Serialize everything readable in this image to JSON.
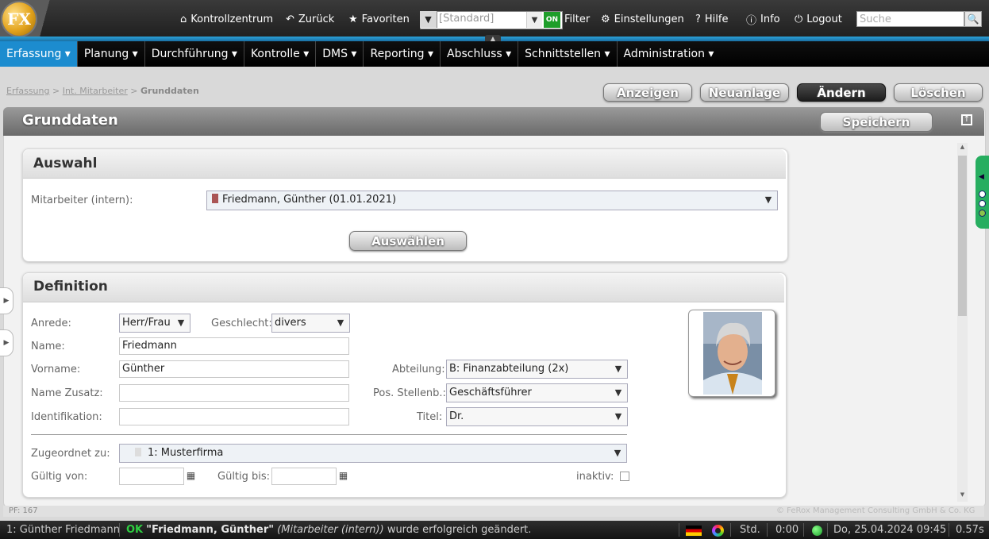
{
  "header": {
    "nav": [
      {
        "label": "Kontrollzentrum",
        "icon": "home-icon"
      },
      {
        "label": "Zurück",
        "icon": "undo-icon"
      },
      {
        "label": "Favoriten",
        "icon": "star-icon"
      }
    ],
    "filter": {
      "selected": "[Standard]",
      "status": "ON",
      "label": "Filter"
    },
    "nav_right": [
      {
        "label": "Einstellungen",
        "icon": "gear-icon"
      },
      {
        "label": "Hilfe",
        "icon": "help-icon"
      },
      {
        "label": "Info",
        "icon": "info-icon"
      },
      {
        "label": "Logout",
        "icon": "power-icon"
      }
    ],
    "search_placeholder": "Suche",
    "logo_letters": "FX"
  },
  "menu": [
    {
      "label": "Erfassung ▾",
      "active": true
    },
    {
      "label": "Planung ▾"
    },
    {
      "label": "Durchführung ▾"
    },
    {
      "label": "Kontrolle ▾"
    },
    {
      "label": "DMS ▾"
    },
    {
      "label": "Reporting ▾"
    },
    {
      "label": "Abschluss ▾"
    },
    {
      "label": "Schnittstellen ▾"
    },
    {
      "label": "Administration ▾"
    }
  ],
  "breadcrumb": {
    "part1": "Erfassung",
    "part2": "Int. Mitarbeiter",
    "current": "Grunddaten",
    "sep": ">"
  },
  "actions": {
    "show": "Anzeigen",
    "new": "Neuanlage",
    "edit": "Ändern",
    "delete": "Löschen"
  },
  "panel": {
    "title": "Grunddaten",
    "save": "Speichern"
  },
  "auswahl": {
    "title": "Auswahl",
    "employee_label": "Mitarbeiter (intern):",
    "employee_value": "Friedmann, Günther (01.01.2021)",
    "select_button": "Auswählen"
  },
  "definition": {
    "title": "Definition",
    "anrede_label": "Anrede:",
    "anrede_value": "Herr/Frau",
    "geschlecht_label": "Geschlecht:",
    "geschlecht_value": "divers",
    "name_label": "Name:",
    "name_value": "Friedmann",
    "vorname_label": "Vorname:",
    "vorname_value": "Günther",
    "namezusatz_label": "Name Zusatz:",
    "namezusatz_value": "",
    "identifikation_label": "Identifikation:",
    "identifikation_value": "",
    "abteilung_label": "Abteilung:",
    "abteilung_value": "B: Finanzabteilung (2x)",
    "stelle_label": "Pos. Stellenb.:",
    "stelle_value": "Geschäftsführer",
    "titel_label": "Titel:",
    "titel_value": "Dr.",
    "zugeordnet_label": "Zugeordnet zu:",
    "zugeordnet_value": "1: Musterfirma",
    "gueltig_von_label": "Gültig von:",
    "gueltig_von_value": "",
    "gueltig_bis_label": "Gültig bis:",
    "gueltig_bis_value": "",
    "inaktiv_label": "inaktiv:",
    "inaktiv_checked": false
  },
  "footer": {
    "pf": "PF: 167",
    "copyright": "© FeRox Management Consulting GmbH & Co. KG"
  },
  "statusbar": {
    "user": "1: Günther Friedmann",
    "ok": "OK",
    "message_name": "\"Friedmann, Günther\"",
    "message_type": "(Mitarbeiter (intern))",
    "message_rest": "wurde erfolgreich geändert.",
    "mode": "Std.",
    "time": "0:00",
    "datetime": "Do, 25.04.2024 09:45",
    "duration": "0.57s"
  },
  "colors": {
    "accent": "#1c8ccf",
    "ok_green": "#27ae60"
  }
}
